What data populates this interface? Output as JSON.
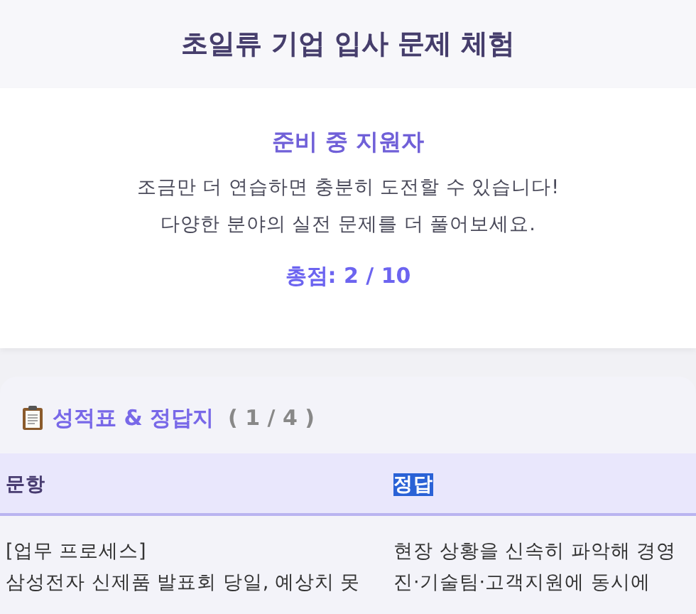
{
  "header": {
    "title": "초일류 기업 입사 문제 체험"
  },
  "result": {
    "rank": "준비 중 지원자",
    "message_lines": [
      "조금만 더 연습하면 충분히 도전할 수 있습니다!",
      "다양한 분야의 실전 문제를 더 풀어보세요."
    ],
    "score": "총점: 2 / 10"
  },
  "answer_sheet": {
    "title": "성적표 & 정답지",
    "page": "( 1 / 4 )",
    "columns": [
      {
        "label": "문항",
        "highlighted": false
      },
      {
        "label": "정답",
        "highlighted": true
      }
    ],
    "rows": [
      {
        "cells": [
          [
            "[업무 프로세스]",
            "삼성전자 신제품 발표회 당일, 예상치 못"
          ],
          [
            "현장 상황을 신속히 파악해 경영",
            "진·기술팀·고객지원에 동시에"
          ]
        ]
      }
    ]
  }
}
